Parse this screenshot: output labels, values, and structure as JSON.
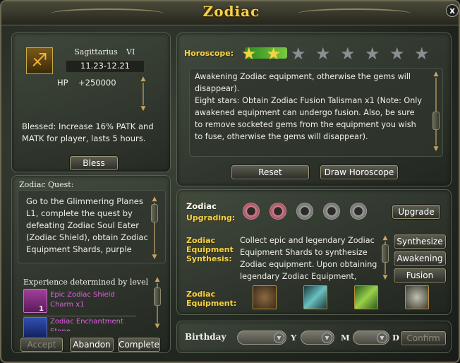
{
  "window": {
    "title": "Zodiac",
    "close": "x"
  },
  "sign": {
    "name": "Sagittarius",
    "level": "VI",
    "dates": "11.23-12.21",
    "hp_label": "HP",
    "hp_value": "+250000",
    "symbol": "♐"
  },
  "blessing": {
    "text": "Blessed: Increase 16% PATK and MATK for player, lasts 5 hours.",
    "button": "Bless"
  },
  "quest": {
    "header": "Zodiac Quest:",
    "text": "Go to the Glimmering Planes L1, complete the quest by defeating Zodiac Soul Eater (Zodiac Shield), obtain Zodiac Equipment Shards, purple",
    "exp_label": "Experience determined by level",
    "rewards": [
      {
        "name": "Epic Zodiac Shield Charm x1",
        "count": "1"
      },
      {
        "name": "Zodiac Enchantment Stone",
        "count": ""
      }
    ],
    "buttons": {
      "accept": "Accept",
      "abandon": "Abandon",
      "complete": "Complete"
    }
  },
  "horoscope": {
    "label": "Horoscope:",
    "stars_total": 8,
    "stars_lit": 2,
    "text": "Awakening Zodiac equipment, otherwise the gems will disappear).\nEight stars: Obtain Zodiac Fusion Talisman x1 (Note: Only awakened equipment can undergo fusion. Also, be sure to remove socketed gems from the equipment you wish to fuse, otherwise the gems will disappear).",
    "buttons": {
      "reset": "Reset",
      "draw": "Draw Horoscope"
    }
  },
  "upgrading": {
    "label1": "Zodiac",
    "label2": "Upgrading:",
    "hearts_total": 5,
    "hearts_lit": 2,
    "button": "Upgrade"
  },
  "synthesis": {
    "label1": "Zodiac",
    "label2": "Equipment",
    "label3": "Synthesis:",
    "text": "Collect epic and legendary Zodiac Equipment Shards to synthesize Zodiac equipment. Upon obtaining legendary Zodiac Equipment,",
    "buttons": {
      "synthesize": "Synthesize",
      "awakening": "Awakening",
      "fusion": "Fusion"
    }
  },
  "equipment": {
    "label1": "Zodiac",
    "label2": "Equipment:",
    "items": [
      "armor-icon",
      "sword-icon",
      "scroll-icon",
      "shield-icon"
    ]
  },
  "birthday": {
    "label": "Birthday",
    "y": "Y",
    "m": "M",
    "d": "D",
    "confirm": "Confirm"
  },
  "colors": {
    "gold": "#f2d24a",
    "star_lit": "#f5d442",
    "star_dim": "#8a8f92",
    "heart_lit": "#e07a8c",
    "heart_dim": "#a0a0a0"
  }
}
